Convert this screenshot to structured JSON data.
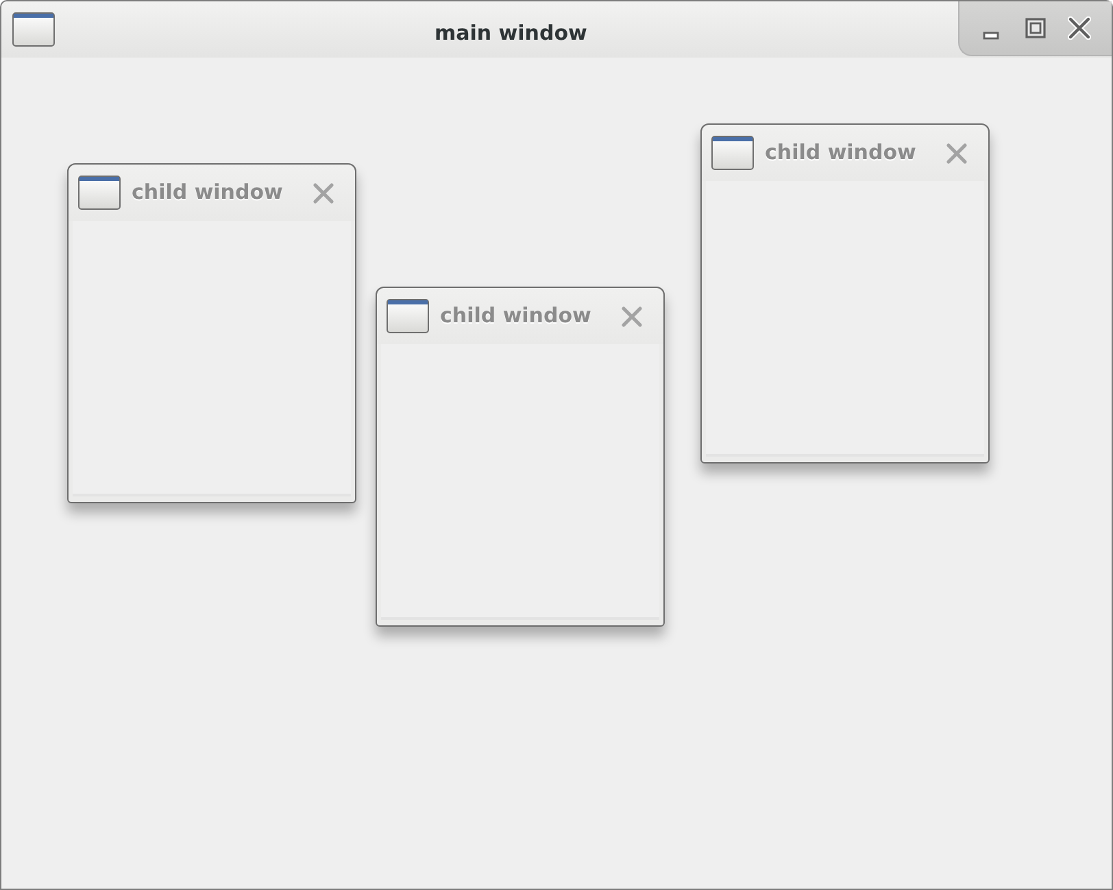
{
  "window": {
    "title": "main window"
  },
  "child_windows": [
    {
      "title": "child window",
      "active": false
    },
    {
      "title": "child window",
      "active": false
    },
    {
      "title": "child window",
      "active": false
    }
  ]
}
